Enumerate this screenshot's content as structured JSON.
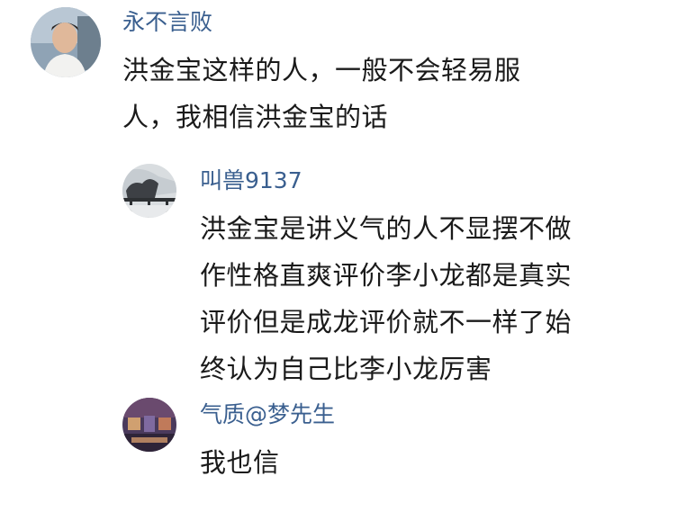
{
  "comments": [
    {
      "username": "永不言败",
      "lines": [
        "洪金宝这样的人，一般不会轻易服",
        "人，我相信洪金宝的话"
      ],
      "avatar": "avatar-young-man-photo"
    },
    {
      "username": "叫兽9137",
      "lines": [
        "洪金宝是讲义气的人不显摆不做",
        "作性格直爽评价李小龙都是真实",
        "评价但是成龙评价就不一样了始",
        "终认为自己比李小龙厉害"
      ],
      "avatar": "avatar-bridge-photo"
    },
    {
      "username": "气质@梦先生",
      "lines": [
        "我也信"
      ],
      "avatar": "avatar-game-screenshot"
    }
  ],
  "colors": {
    "username": "#3a5f8f",
    "text": "#1a1a1a",
    "background": "#ffffff"
  }
}
